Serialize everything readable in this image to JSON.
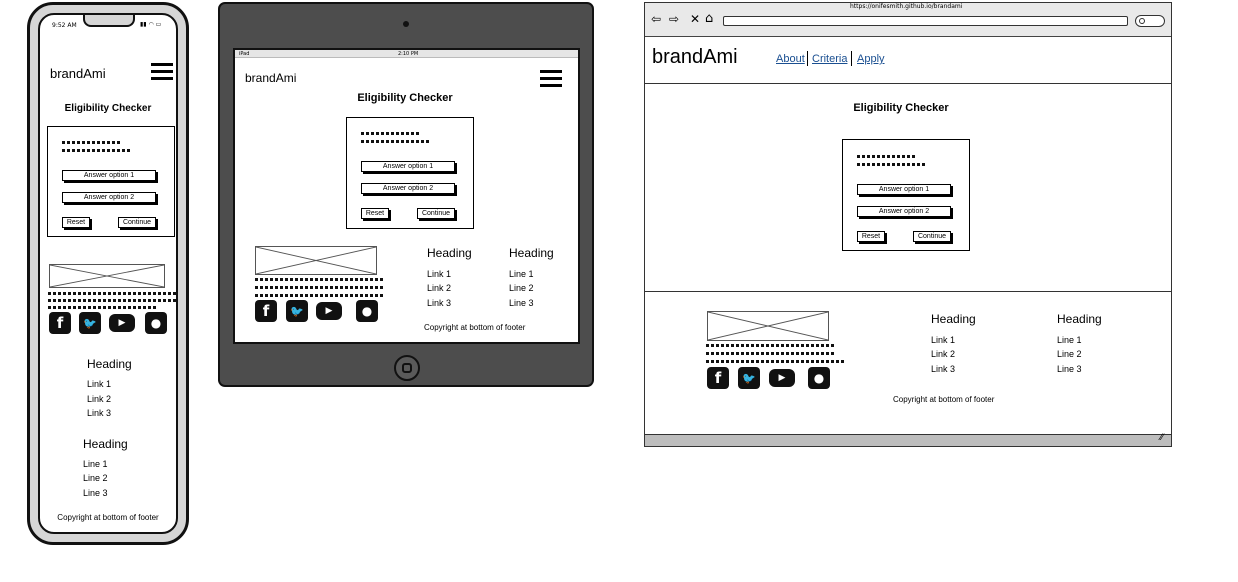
{
  "brand": "brandAmi",
  "title": "Eligibility Checker",
  "answer_option_1": "Answer option 1",
  "answer_option_2": "Answer option 2",
  "reset": "Reset",
  "continue": "Continue",
  "heading": "Heading",
  "links": [
    "Link 1",
    "Link 2",
    "Link 3"
  ],
  "lines": [
    "Line 1",
    "Line 2",
    "Line 3"
  ],
  "copyright": "Copyright at bottom of footer",
  "phone_status": {
    "time": "9:52 AM"
  },
  "tablet_status": {
    "device": "iPad",
    "time": "2:10 PM"
  },
  "browser": {
    "url": "https://onifesmith.github.io/brandami",
    "nav": [
      "About",
      "Criteria",
      "Apply"
    ]
  },
  "icons": [
    "facebook-icon",
    "twitter-icon",
    "youtube-icon",
    "github-icon"
  ]
}
